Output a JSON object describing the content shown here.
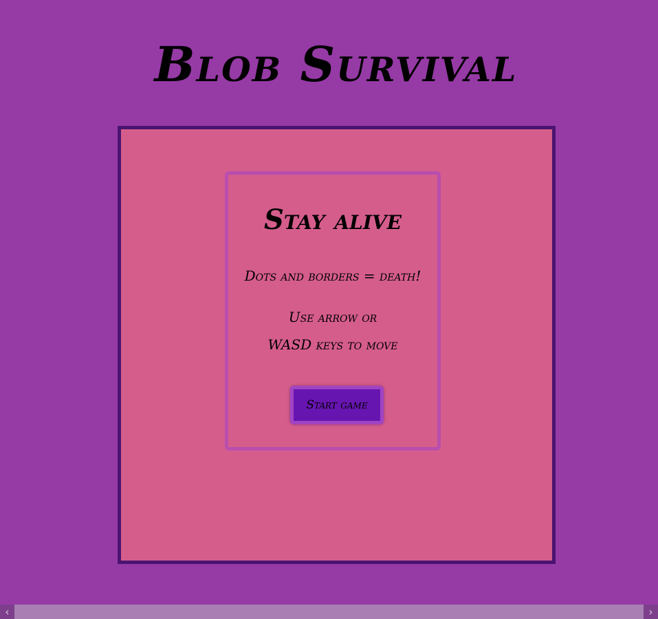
{
  "header": {
    "title": "Blob Survival"
  },
  "start_card": {
    "title": "Stay alive",
    "warning": "Dots and borders = death!",
    "controls_line1": "Use arrow or",
    "controls_line2": "WASD keys to move",
    "start_button": "Start game"
  },
  "scrollbar": {
    "left_icon": "chevron-left-icon",
    "right_icon": "chevron-right-icon"
  },
  "colors": {
    "page_background": "#963aa6",
    "arena_background": "#d55d8c",
    "arena_border": "#4a1470",
    "card_border": "#b94eaf",
    "button_background": "#6715b1"
  }
}
